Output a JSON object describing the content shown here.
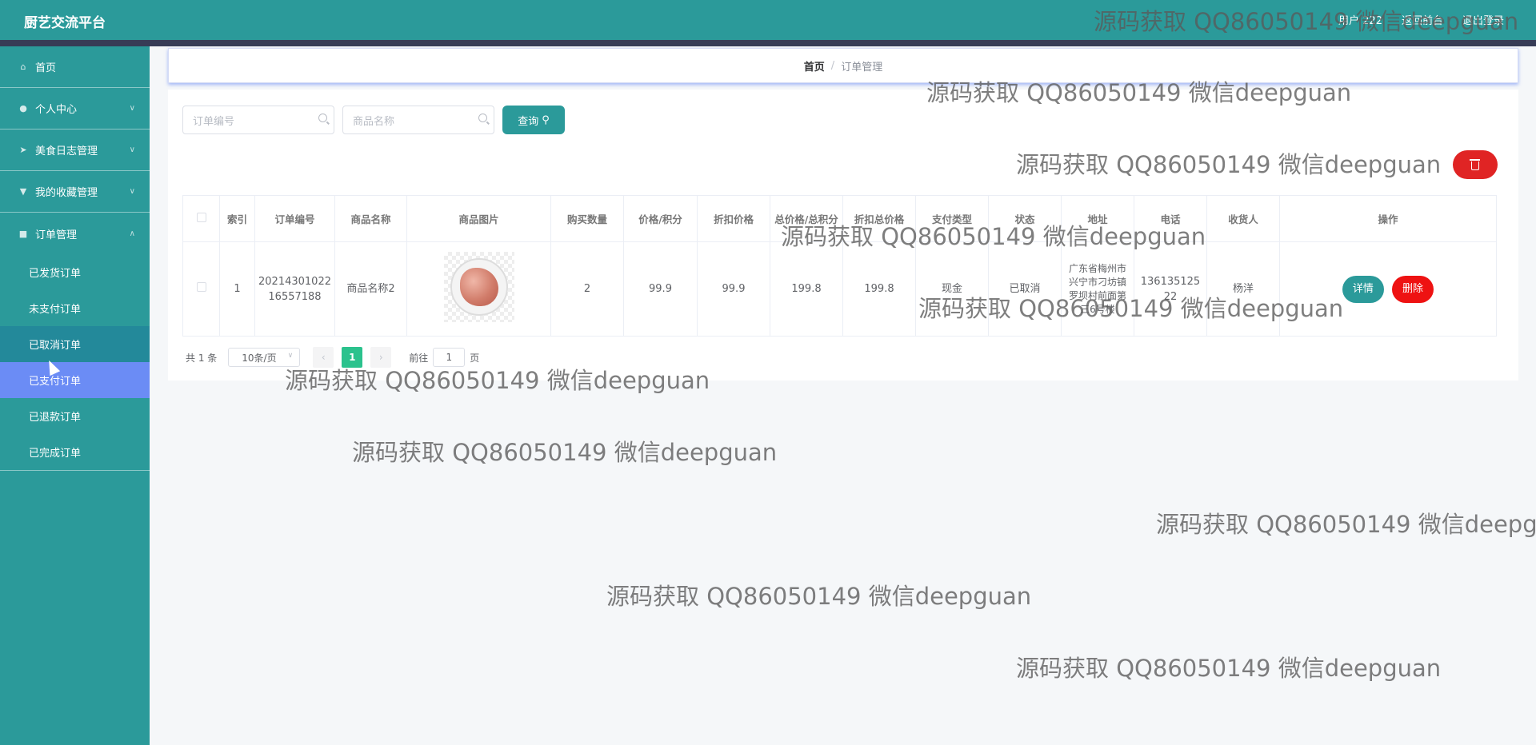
{
  "header": {
    "title": "厨艺交流平台",
    "user_label": "用户 222",
    "nav_front": "返回前台",
    "logout": "退出登录"
  },
  "sidebar": {
    "items": [
      {
        "label": "首页",
        "icon": "home-icon"
      },
      {
        "label": "个人中心",
        "icon": "user-icon"
      },
      {
        "label": "美食日志管理",
        "icon": "send-icon"
      },
      {
        "label": "我的收藏管理",
        "icon": "trophy-icon"
      },
      {
        "label": "订单管理",
        "icon": "document-icon"
      }
    ],
    "sub_items": [
      "已发货订单",
      "未支付订单",
      "已取消订单",
      "已支付订单",
      "已退款订单",
      "已完成订单"
    ]
  },
  "breadcrumb": {
    "home": "首页",
    "separator": "/",
    "current": "订单管理"
  },
  "search": {
    "order_no_placeholder": "订单编号",
    "product_name_placeholder": "商品名称",
    "query_button": "查询"
  },
  "table": {
    "headers": [
      "索引",
      "订单编号",
      "商品名称",
      "商品图片",
      "购买数量",
      "价格/积分",
      "折扣价格",
      "总价格/总积分",
      "折扣总价格",
      "支付类型",
      "状态",
      "地址",
      "电话",
      "收货人",
      "操作"
    ],
    "rows": [
      {
        "index": "1",
        "order_no": "2021430102216557188",
        "product_name": "商品名称2",
        "quantity": "2",
        "price": "99.9",
        "discount_price": "99.9",
        "total": "199.8",
        "discount_total": "199.8",
        "pay_type": "现金",
        "status": "已取消",
        "address": "广东省梅州市兴宁市刁坊镇罗坝村前面第三6号楼",
        "phone": "13613512522",
        "receiver": "杨洋",
        "detail_button": "详情",
        "delete_button": "删除"
      }
    ]
  },
  "pagination": {
    "total": "共 1 条",
    "page_size": "10条/页",
    "current_page": "1",
    "goto_label": "前往",
    "goto_value": "1",
    "page_suffix": "页"
  },
  "watermark": "源码获取 QQ86050149 微信deepguan",
  "colors": {
    "primary": "#2b9a9a",
    "active": "#6b8cf5",
    "danger": "#e02424",
    "page_active": "#2bc28d"
  }
}
